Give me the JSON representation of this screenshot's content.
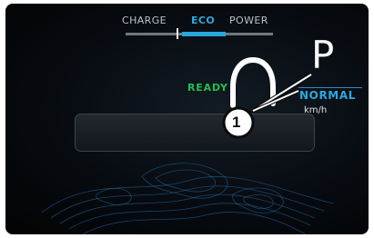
{
  "mode_bar": {
    "labels": [
      "CHARGE",
      "ECO",
      "POWER"
    ],
    "active_mode": "ECO",
    "accent_color": "#2aa6dc"
  },
  "status": {
    "ready_text": "READY",
    "ready_color": "#1fbf52"
  },
  "gear": {
    "current": "P"
  },
  "drive_mode": {
    "label": "NORMAL",
    "color": "#2ca8df"
  },
  "speed": {
    "unit": "km/h"
  },
  "callout": {
    "number": "1"
  },
  "icons": {
    "terrain": "contour-terrain-graphic",
    "callout": "numbered-callout-circle"
  }
}
